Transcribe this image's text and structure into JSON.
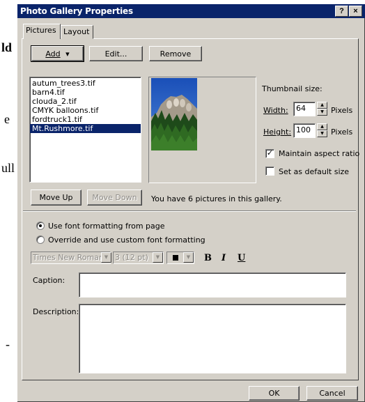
{
  "background_document": {
    "fragments": [
      "ld",
      "e",
      "ull",
      "-"
    ]
  },
  "window": {
    "title": "Photo Gallery Properties",
    "help_label": "?",
    "close_label": "×"
  },
  "tabs": [
    {
      "label": "Pictures",
      "active": true
    },
    {
      "label": "Layout",
      "active": false
    }
  ],
  "toolbar": {
    "add_label": "Add",
    "add_dropdown_glyph": "▾",
    "edit_label": "Edit...",
    "remove_label": "Remove"
  },
  "pictures": {
    "items": [
      "autum_trees3.tif",
      "barn4.tif",
      "clouda_2.tif",
      "CMYK balloons.tif",
      "fordtruck1.tif",
      "Mt.Rushmore.tif"
    ],
    "selected_index": 5
  },
  "thumbnail": {
    "heading": "Thumbnail size:",
    "width_label": "Width:",
    "width_value": "64",
    "height_label": "Height:",
    "height_value": "100",
    "unit_label": "Pixels",
    "maintain_aspect_label": "Maintain aspect ratio",
    "maintain_aspect_checked": true,
    "default_size_label": "Set as default size",
    "default_size_checked": false
  },
  "order": {
    "move_up_label": "Move Up",
    "move_down_label": "Move Down",
    "count_text": "You have 6 pictures in this gallery."
  },
  "formatting": {
    "use_page_label": "Use font formatting from page",
    "override_label": "Override and use custom font formatting",
    "selected_option": "page",
    "font_name": "Times New Roman",
    "font_size": "3  (12 pt)",
    "bold_label": "B",
    "italic_label": "I",
    "underline_label": "U"
  },
  "fields": {
    "caption_label": "Caption:",
    "caption_value": "",
    "description_label": "Description:",
    "description_value": ""
  },
  "footer": {
    "ok_label": "OK",
    "cancel_label": "Cancel"
  },
  "colors": {
    "title_bar": "#0a246a",
    "dialog_face": "#d4d0c8",
    "selection": "#0a246a"
  }
}
